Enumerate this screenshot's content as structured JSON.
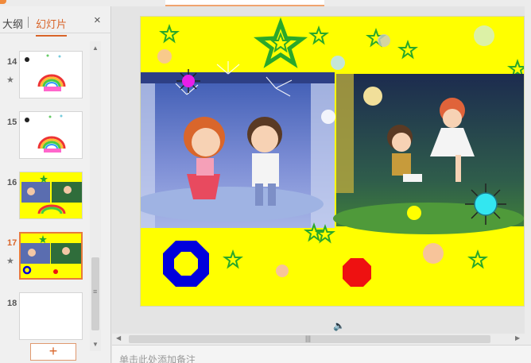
{
  "left_panel": {
    "tab_outline": "大纲",
    "tab_slides": "幻灯片",
    "close_glyph": "×",
    "add_glyph": "+"
  },
  "thumbnails": [
    {
      "number": "14",
      "has_star": true,
      "active": false
    },
    {
      "number": "15",
      "has_star": false,
      "active": false
    },
    {
      "number": "16",
      "has_star": false,
      "active": false
    },
    {
      "number": "17",
      "has_star": true,
      "active": true
    },
    {
      "number": "18",
      "has_star": false,
      "active": false
    }
  ],
  "slide": {
    "background_color": "#ffff00"
  },
  "notes": {
    "placeholder": "单击此处添加备注"
  },
  "colors": {
    "accent": "#d9652a",
    "slide_bg": "#ffff00",
    "star_green": "#2aa82a",
    "octagon_blue": "#0000dd",
    "octagon_red": "#ee1111"
  }
}
